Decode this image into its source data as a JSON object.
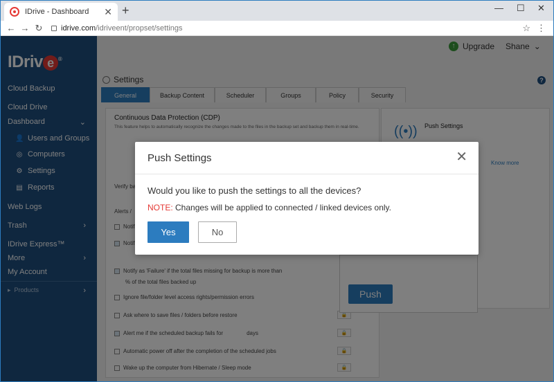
{
  "browser": {
    "tab_title": "IDrive - Dashboard",
    "url_host": "idrive.com",
    "url_path": "/idriveent/propset/settings"
  },
  "header": {
    "upgrade": "Upgrade",
    "user": "Shane"
  },
  "sidebar": {
    "logo": "IDriv",
    "logo_e": "e",
    "items": {
      "cloud_backup": "Cloud Backup",
      "cloud_drive": "Cloud Drive",
      "dashboard": "Dashboard",
      "users_groups": "Users and Groups",
      "computers": "Computers",
      "settings": "Settings",
      "reports": "Reports",
      "web_logs": "Web Logs",
      "trash": "Trash",
      "idrive_express": "IDrive Express™",
      "more": "More",
      "my_account": "My Account",
      "products": "Products"
    }
  },
  "page": {
    "title": "Settings",
    "tabs": [
      "General",
      "Backup Content",
      "Scheduler",
      "Groups",
      "Policy",
      "Security"
    ],
    "cdp_title": "Continuous Data Protection (CDP)",
    "cdp_desc": "This feature helps to automatically recognize the changes made to the files in the backup set and backup them in real-time.",
    "verify": "Verify ba",
    "alerts": "Alerts /",
    "notify_partial": "Notif",
    "notify_failure": "Notify as 'Failure' if the total files missing for backup is more than",
    "pct_label": "% of the total files backed up",
    "ignore": "Ignore file/folder level access rights/permission errors",
    "ask_where": "Ask where to save files / folders before restore",
    "alert_fail": "Alert me if the scheduled backup fails for",
    "days": "days",
    "power_off": "Automatic power off after the completion of the scheduled jobs",
    "wake_up": "Wake up the computer from Hibernate / Sleep mode",
    "push_settings_title": "Push Settings",
    "push_button": "Push",
    "learn_more": "Know more"
  },
  "modal": {
    "title": "Push Settings",
    "question": "Would you like to push the settings to all the devices?",
    "note_label": "NOTE:",
    "note_text": " Changes will be applied to connected / linked devices only.",
    "yes": "Yes",
    "no": "No"
  },
  "colors": {
    "sidebar": "#1e4e7f",
    "accent": "#2c7cbf",
    "note": "#e53935"
  }
}
